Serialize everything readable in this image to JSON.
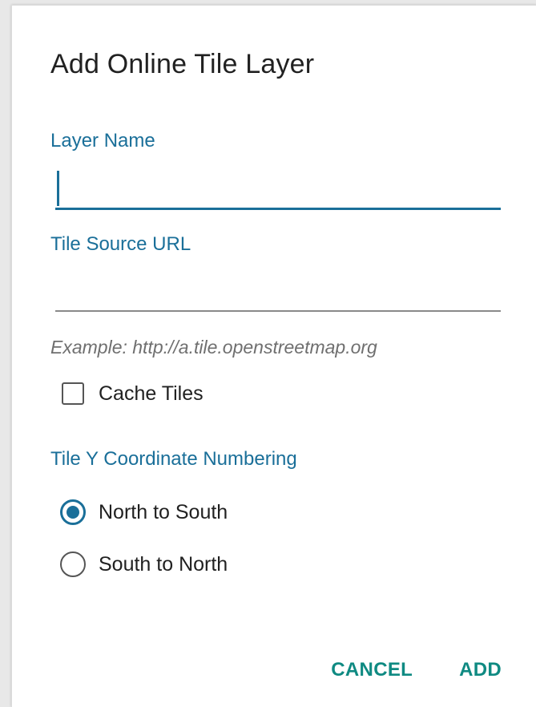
{
  "dialog": {
    "title": "Add Online Tile Layer"
  },
  "layer_name": {
    "label": "Layer Name",
    "value": "",
    "placeholder": ""
  },
  "tile_source_url": {
    "label": "Tile Source URL",
    "value": "",
    "placeholder": "",
    "example": "Example: http://a.tile.openstreetmap.org"
  },
  "cache_tiles": {
    "label": "Cache Tiles",
    "checked": false
  },
  "coordinate_numbering": {
    "label": "Tile Y Coordinate Numbering",
    "options": [
      {
        "label": "North to South",
        "selected": true
      },
      {
        "label": "South to North",
        "selected": false
      }
    ]
  },
  "actions": {
    "cancel_label": "CANCEL",
    "add_label": "ADD"
  },
  "colors": {
    "accent": "#1a6f99",
    "button_text": "#0f8a82",
    "text_primary": "#212121",
    "hint_text": "#6f6f6f"
  }
}
